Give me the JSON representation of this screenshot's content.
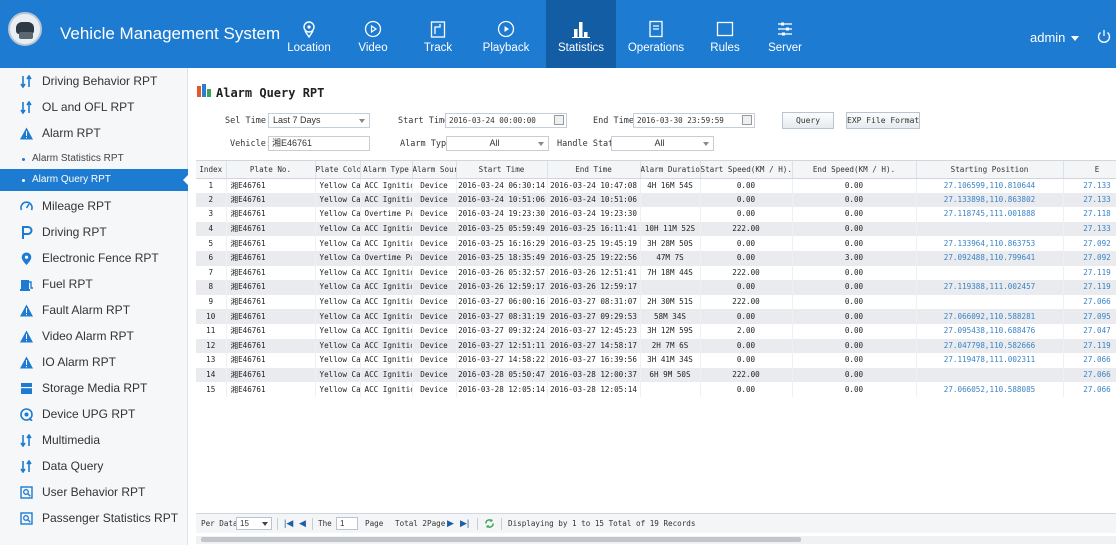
{
  "app": {
    "title": "Vehicle Management System"
  },
  "nav": [
    {
      "label": "Location",
      "icon": "location-pin-icon"
    },
    {
      "label": "Video",
      "icon": "video-play-icon"
    },
    {
      "label": "Track",
      "icon": "track-icon"
    },
    {
      "label": "Playback",
      "icon": "playback-icon"
    },
    {
      "label": "Statistics",
      "icon": "statistics-icon",
      "active": true
    },
    {
      "label": "Operations",
      "icon": "operations-icon"
    },
    {
      "label": "Rules",
      "icon": "rules-icon"
    },
    {
      "label": "Server",
      "icon": "server-icon"
    }
  ],
  "user": {
    "name": "admin"
  },
  "sidebar": {
    "items": [
      {
        "label": "Driving Behavior RPT",
        "icon": "bar-sort-icon"
      },
      {
        "label": "OL and OFL RPT",
        "icon": "bar-sort-icon"
      },
      {
        "label": "Alarm RPT",
        "icon": "warning-icon"
      },
      {
        "label": "Alarm Statistics RPT"
      },
      {
        "label": "Alarm Query RPT",
        "active": true
      },
      {
        "label": "Mileage RPT",
        "icon": "gauge-icon"
      },
      {
        "label": "Driving RPT",
        "icon": "p-icon"
      },
      {
        "label": "Electronic Fence RPT",
        "icon": "location-pin-icon"
      },
      {
        "label": "Fuel RPT",
        "icon": "fuel-icon"
      },
      {
        "label": "Fault Alarm RPT",
        "icon": "warning-icon"
      },
      {
        "label": "Video Alarm RPT",
        "icon": "warning-icon"
      },
      {
        "label": "IO Alarm RPT",
        "icon": "warning-icon"
      },
      {
        "label": "Storage Media RPT",
        "icon": "storage-icon"
      },
      {
        "label": "Device UPG RPT",
        "icon": "device-upgrade-icon"
      },
      {
        "label": "Multimedia",
        "icon": "bar-sort-icon"
      },
      {
        "label": "Data Query",
        "icon": "bar-sort-icon"
      },
      {
        "label": "User Behavior RPT",
        "icon": "search-doc-icon"
      },
      {
        "label": "Passenger Statistics RPT",
        "icon": "search-doc-icon"
      }
    ]
  },
  "page": {
    "title": "Alarm Query RPT"
  },
  "filters": {
    "sel_time_label": "Sel Time:",
    "sel_time_value": "Last 7 Days",
    "start_time_label": "Start Time:",
    "start_time_value": "2016-03-24 00:00:00",
    "end_time_label": "End Time:",
    "end_time_value": "2016-03-30 23:59:59",
    "query_label": "Query",
    "exp_label": "EXP File Format",
    "vehicle_label": "Vehicle:",
    "vehicle_value": "湘E46761",
    "alarm_type_label": "Alarm Type:",
    "alarm_type_value": "All",
    "handle_status_label": "Handle Status:",
    "handle_status_value": "All"
  },
  "table": {
    "columns": [
      "Index",
      "Plate No.",
      "Plate Color",
      "Alarm Type",
      "Alarm Source",
      "Start Time",
      "End Time",
      "Alarm Duration",
      "Start Speed(KM / H).",
      "End Speed(KM / H).",
      "Starting Position",
      "E"
    ],
    "rows": [
      [
        "1",
        "湘E46761",
        "Yellow Card",
        "ACC Ignition",
        "Device",
        "2016-03-24 06:30:14",
        "2016-03-24 10:47:08",
        "4H 16M 54S",
        "0.00",
        "0.00",
        "27.106599,110.810644",
        "27.133"
      ],
      [
        "2",
        "湘E46761",
        "Yellow Card",
        "ACC Ignition",
        "Device",
        "2016-03-24 10:51:06",
        "2016-03-24 10:51:06",
        "",
        "0.00",
        "0.00",
        "27.133898,110.863802",
        "27.133"
      ],
      [
        "3",
        "湘E46761",
        "Yellow Card",
        "Overtime Parking",
        "Device",
        "2016-03-24 19:23:30",
        "2016-03-24 19:23:30",
        "",
        "0.00",
        "0.00",
        "27.118745,111.001888",
        "27.118"
      ],
      [
        "4",
        "湘E46761",
        "Yellow Card",
        "ACC Ignition",
        "Device",
        "2016-03-25 05:59:49",
        "2016-03-25 16:11:41",
        "10H 11M 52S",
        "222.00",
        "0.00",
        "",
        "27.133"
      ],
      [
        "5",
        "湘E46761",
        "Yellow Card",
        "ACC Ignition",
        "Device",
        "2016-03-25 16:16:29",
        "2016-03-25 19:45:19",
        "3H 28M 50S",
        "0.00",
        "0.00",
        "27.133964,110.863753",
        "27.092"
      ],
      [
        "6",
        "湘E46761",
        "Yellow Card",
        "Overtime Parking",
        "Device",
        "2016-03-25 18:35:49",
        "2016-03-25 19:22:56",
        "47M 7S",
        "0.00",
        "3.00",
        "27.092488,110.799641",
        "27.092"
      ],
      [
        "7",
        "湘E46761",
        "Yellow Card",
        "ACC Ignition",
        "Device",
        "2016-03-26 05:32:57",
        "2016-03-26 12:51:41",
        "7H 18M 44S",
        "222.00",
        "0.00",
        "",
        "27.119"
      ],
      [
        "8",
        "湘E46761",
        "Yellow Card",
        "ACC Ignition",
        "Device",
        "2016-03-26 12:59:17",
        "2016-03-26 12:59:17",
        "",
        "0.00",
        "0.00",
        "27.119388,111.002457",
        "27.119"
      ],
      [
        "9",
        "湘E46761",
        "Yellow Card",
        "ACC Ignition",
        "Device",
        "2016-03-27 06:00:16",
        "2016-03-27 08:31:07",
        "2H 30M 51S",
        "222.00",
        "0.00",
        "",
        "27.066"
      ],
      [
        "10",
        "湘E46761",
        "Yellow Card",
        "ACC Ignition",
        "Device",
        "2016-03-27 08:31:19",
        "2016-03-27 09:29:53",
        "58M 34S",
        "0.00",
        "0.00",
        "27.066092,110.588281",
        "27.095"
      ],
      [
        "11",
        "湘E46761",
        "Yellow Card",
        "ACC Ignition",
        "Device",
        "2016-03-27 09:32:24",
        "2016-03-27 12:45:23",
        "3H 12M 59S",
        "2.00",
        "0.00",
        "27.095438,110.688476",
        "27.047"
      ],
      [
        "12",
        "湘E46761",
        "Yellow Card",
        "ACC Ignition",
        "Device",
        "2016-03-27 12:51:11",
        "2016-03-27 14:58:17",
        "2H 7M 6S",
        "0.00",
        "0.00",
        "27.047798,110.582666",
        "27.119"
      ],
      [
        "13",
        "湘E46761",
        "Yellow Card",
        "ACC Ignition",
        "Device",
        "2016-03-27 14:58:22",
        "2016-03-27 16:39:56",
        "3H 41M 34S",
        "0.00",
        "0.00",
        "27.119478,111.002311",
        "27.066"
      ],
      [
        "14",
        "湘E46761",
        "Yellow Card",
        "ACC Ignition",
        "Device",
        "2016-03-28 05:50:47",
        "2016-03-28 12:00:37",
        "6H 9M 50S",
        "222.00",
        "0.00",
        "",
        "27.066"
      ],
      [
        "15",
        "湘E46761",
        "Yellow Card",
        "ACC Ignition",
        "Device",
        "2016-03-28 12:05:14",
        "2016-03-28 12:05:14",
        "",
        "0.00",
        "0.00",
        "27.066052,110.588085",
        "27.066"
      ]
    ]
  },
  "pager": {
    "per_data_label": "Per Data",
    "per_data_value": "15",
    "the_label": "The",
    "page_value": "1",
    "page_label": "Page",
    "total_pages": "Total 2Page",
    "summary": "Displaying by 1 to 15 Total of 19 Records"
  },
  "colors": {
    "header": "#1d7bd1",
    "active_tab": "#135da4",
    "link": "#3a83c6",
    "row_stripe": "#e9ebee"
  }
}
